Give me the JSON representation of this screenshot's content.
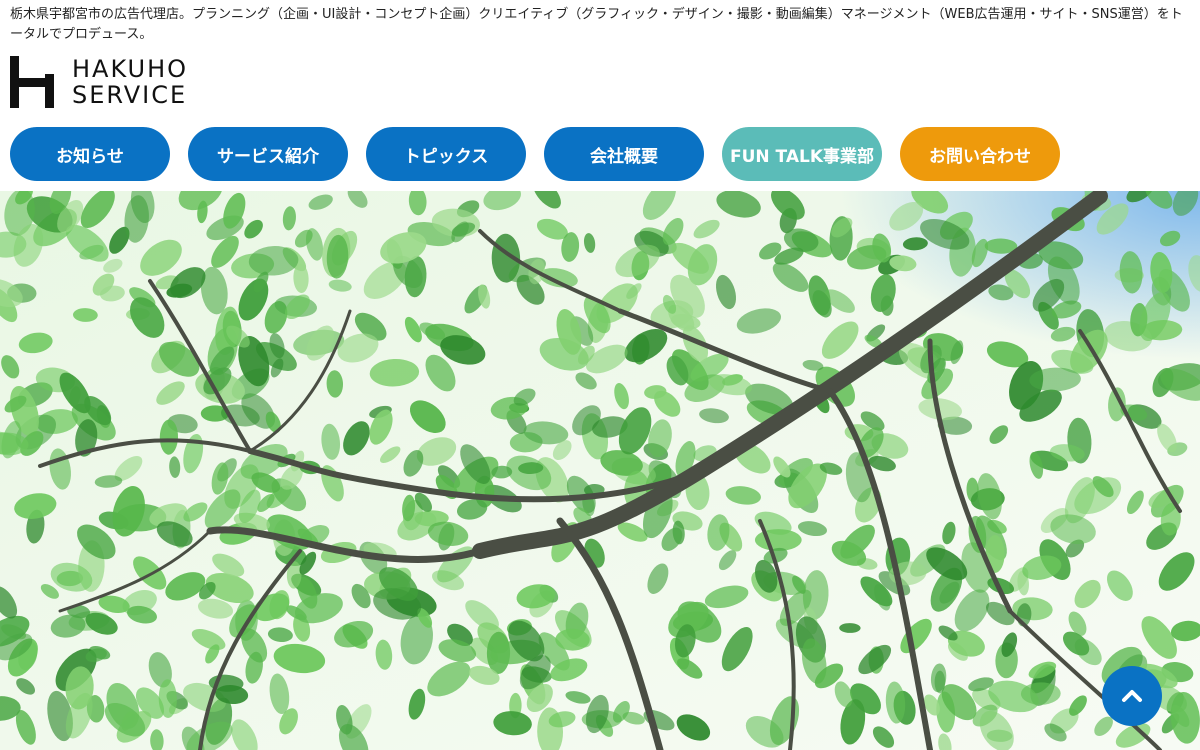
{
  "header": {
    "tagline": "栃木県宇都宮市の広告代理店。プランニング（企画・UI設計・コンセプト企画）クリエイティブ（グラフィック・デザイン・撮影・動画編集）マネージメント（WEB広告運用・サイト・SNS運営）をトータルでプロデュース。",
    "logo_line1": "HAKUHO",
    "logo_line2": "SERVICE"
  },
  "nav": {
    "items": [
      {
        "label": "お知らせ",
        "color": "#0a72c4"
      },
      {
        "label": "サービス紹介",
        "color": "#0a72c4"
      },
      {
        "label": "トピックス",
        "color": "#0a72c4"
      },
      {
        "label": "会社概要",
        "color": "#0a72c4"
      },
      {
        "label": "FUN TALK事業部",
        "color": "#5bbcb8"
      },
      {
        "label": "お問い合わせ",
        "color": "#ee9a0c"
      }
    ]
  },
  "hero": {
    "image": "tree-canopy-photo"
  },
  "page_top": {
    "icon": "chevron-up-icon",
    "color": "#0a72c4"
  }
}
